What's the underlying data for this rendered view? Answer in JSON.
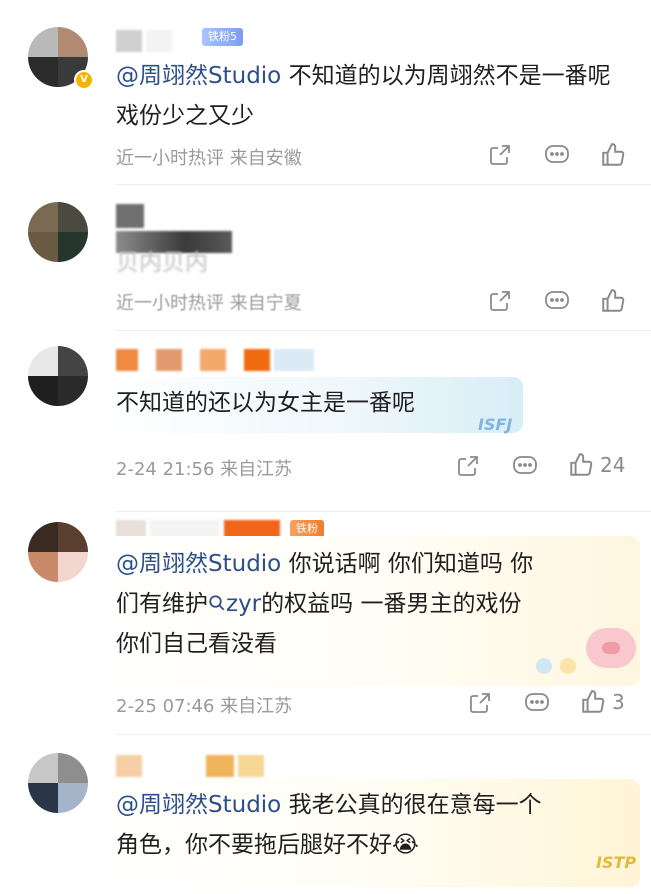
{
  "comments": [
    {
      "id": 1,
      "fan_badge": "铁粉5",
      "mention": "@周翊然Studio",
      "text": " 不知道的以为周翊然不是一番呢 戏份少之又少",
      "meta": "近一小时热评  来自安徽",
      "like_count": ""
    },
    {
      "id": 2,
      "text": "贝内贝内",
      "meta": "近一小时热评  来自宁夏",
      "like_count": ""
    },
    {
      "id": 3,
      "text": "不知道的还以为女主是一番呢",
      "meta": "2-24 21:56 来自江苏",
      "like_count": "24",
      "sticker": "ISFJ"
    },
    {
      "id": 4,
      "fan_badge": "铁粉",
      "mention": "@周翊然Studio",
      "text_line1": " 你说话啊 你们知道吗 你",
      "text_line2_a": "们有维护",
      "search_term": "zyr",
      "text_line2_b": "的权益吗 一番男主的戏份",
      "text_line3": "你们自己看没看",
      "meta": "2-25 07:46 来自江苏",
      "like_count": "3"
    },
    {
      "id": 5,
      "mention": "@周翊然Studio",
      "text_line1": " 我老公真的很在意每一个",
      "text_line2": "角色，你不要拖后腿好不好",
      "emoji": "😭",
      "sticker": "ISTP"
    }
  ],
  "colors": {
    "mention": "#2c4f8a",
    "meta": "#9a9a9a",
    "verified": "#f6b400"
  },
  "icons": [
    "share-icon",
    "comment-icon",
    "like-icon",
    "search-icon",
    "verified-icon"
  ]
}
